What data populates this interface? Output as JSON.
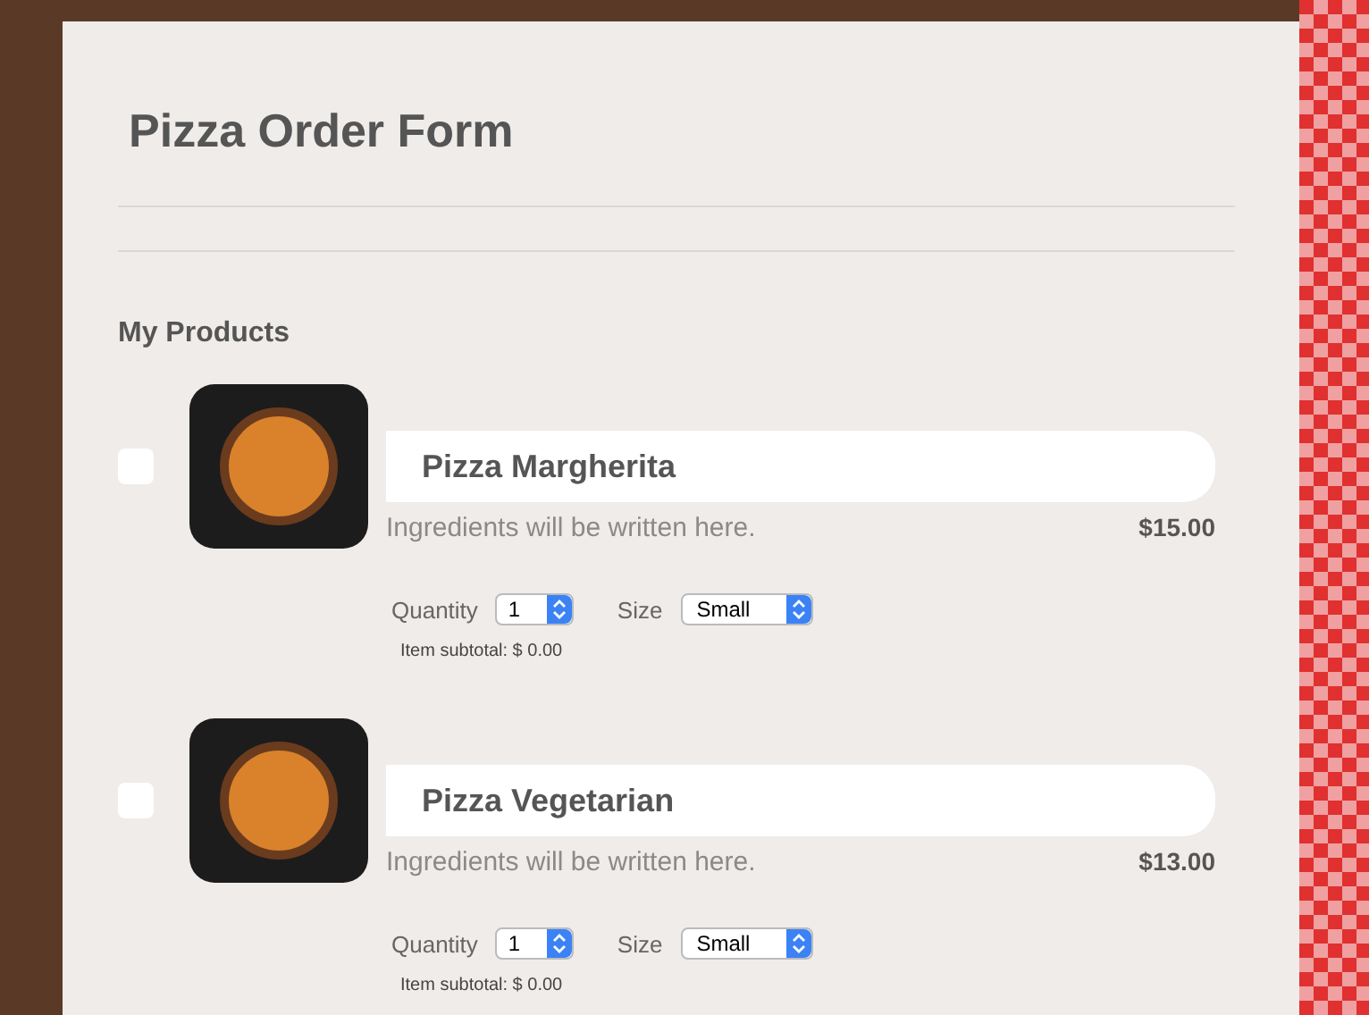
{
  "form": {
    "title": "Pizza Order Form"
  },
  "section": {
    "label": "My Products"
  },
  "products": [
    {
      "name": "Pizza Margherita",
      "description": "Ingredients will be written here.",
      "price": "$15.00",
      "checked": false,
      "quantity_label": "Quantity",
      "quantity": "1",
      "size_label": "Size",
      "size": "Small",
      "subtotal": "Item subtotal: $ 0.00"
    },
    {
      "name": "Pizza Vegetarian",
      "description": "Ingredients will be written here.",
      "price": "$13.00",
      "checked": false,
      "quantity_label": "Quantity",
      "quantity": "1",
      "size_label": "Size",
      "size": "Small",
      "subtotal": "Item subtotal: $ 0.00"
    }
  ]
}
